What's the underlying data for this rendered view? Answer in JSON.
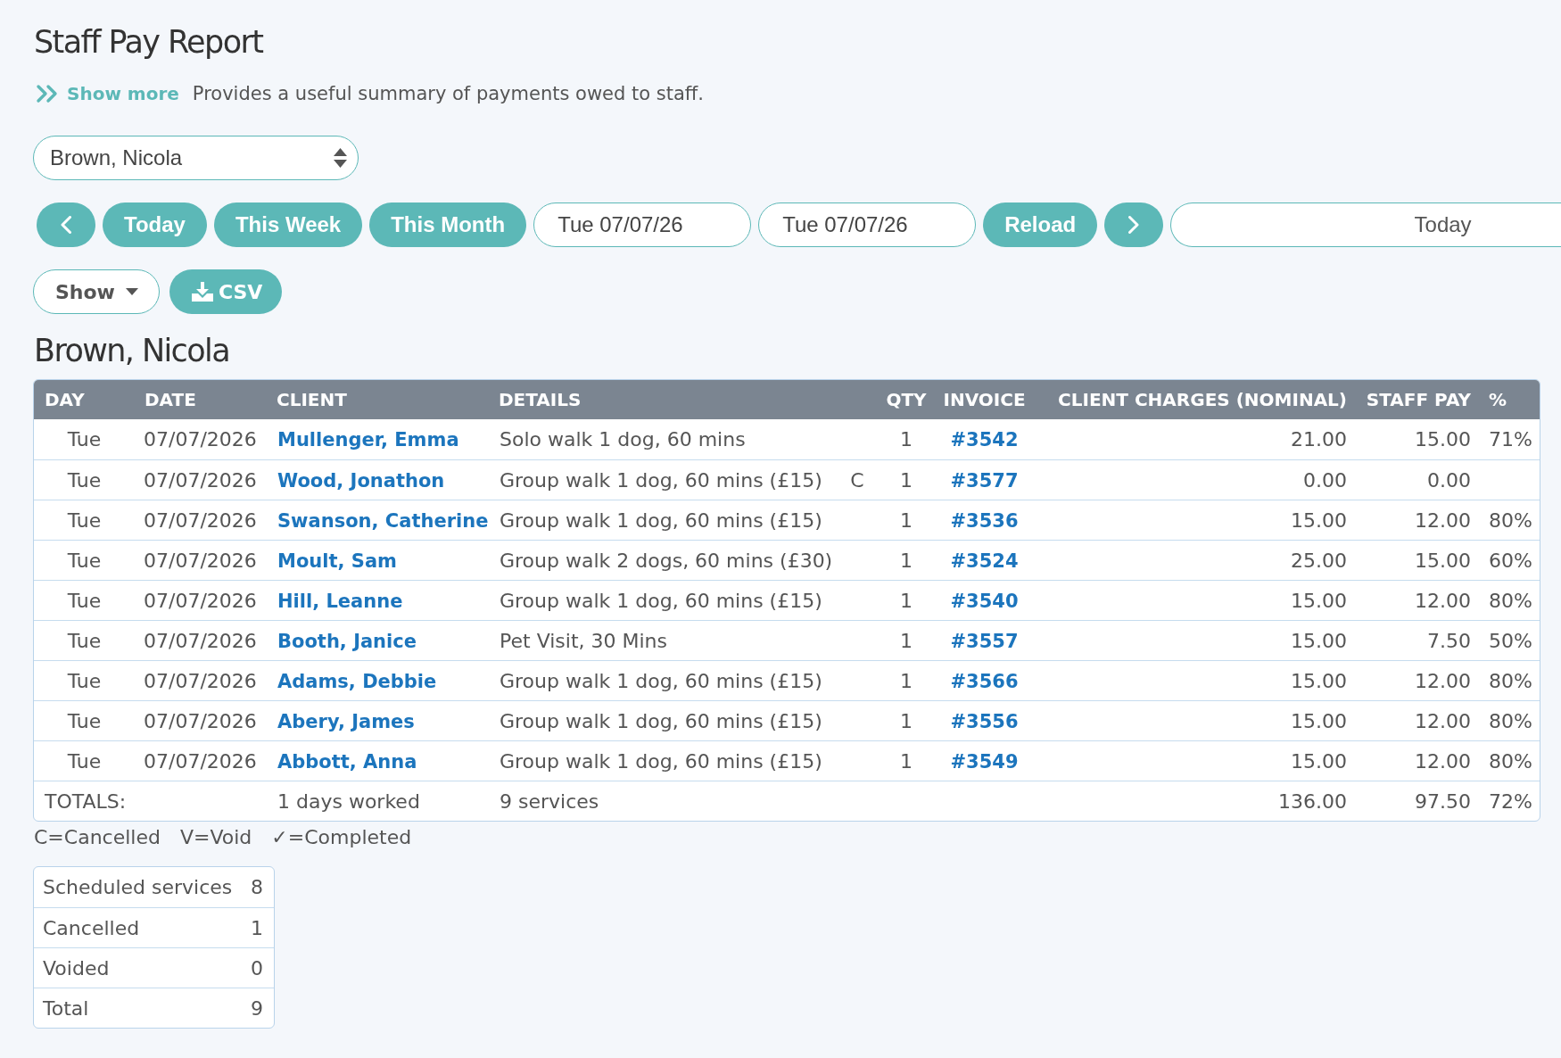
{
  "title": "Staff Pay Report",
  "intro": {
    "show_more": "Show more",
    "description": "Provides a useful summary of payments owed to staff."
  },
  "staff_select": {
    "value": "Brown, Nicola"
  },
  "date_toolbar": {
    "presets": [
      "Today",
      "This Week",
      "This Month"
    ],
    "start_date": {
      "value": "Tue 07/07/26"
    },
    "end_date": {
      "value": "Tue 07/07/26"
    },
    "reload": "Reload",
    "range": {
      "value": "Today"
    }
  },
  "actions": [
    {
      "kind": "dropdown",
      "label": "Show"
    },
    {
      "kind": "download",
      "label": "CSV"
    }
  ],
  "report": {
    "heading": "Brown, Nicola",
    "columns": [
      "DAY",
      "DATE",
      "CLIENT",
      "DETAILS",
      "QTY",
      "INVOICE",
      "CLIENT CHARGES (NOMINAL)",
      "STAFF PAY",
      "%"
    ],
    "rows": [
      {
        "day": "Tue",
        "date": "07/07/2026",
        "client": "Mullenger, Emma",
        "details": "Solo walk 1 dog, 60 mins",
        "qty": "1",
        "invoice": "#3542",
        "charges": "21.00",
        "staff_pay": "15.00",
        "percent": "71%"
      },
      {
        "day": "Tue",
        "date": "07/07/2026",
        "client": "Wood, Jonathon",
        "details": "Group walk 1 dog, 60 mins (£15)",
        "status": "C",
        "qty": "1",
        "invoice": "#3577",
        "charges": "0.00",
        "staff_pay": "0.00"
      },
      {
        "day": "Tue",
        "date": "07/07/2026",
        "client": "Swanson, Catherine",
        "details": "Group walk 1 dog, 60 mins (£15)",
        "qty": "1",
        "invoice": "#3536",
        "charges": "15.00",
        "staff_pay": "12.00",
        "percent": "80%"
      },
      {
        "day": "Tue",
        "date": "07/07/2026",
        "client": "Moult, Sam",
        "details": "Group walk 2 dogs, 60 mins (£30)",
        "qty": "1",
        "invoice": "#3524",
        "charges": "25.00",
        "staff_pay": "15.00",
        "percent": "60%"
      },
      {
        "day": "Tue",
        "date": "07/07/2026",
        "client": "Hill, Leanne",
        "details": "Group walk 1 dog, 60 mins (£15)",
        "qty": "1",
        "invoice": "#3540",
        "charges": "15.00",
        "staff_pay": "12.00",
        "percent": "80%"
      },
      {
        "day": "Tue",
        "date": "07/07/2026",
        "client": "Booth, Janice",
        "details": "Pet Visit, 30 Mins",
        "qty": "1",
        "invoice": "#3557",
        "charges": "15.00",
        "staff_pay": "7.50",
        "percent": "50%"
      },
      {
        "day": "Tue",
        "date": "07/07/2026",
        "client": "Adams, Debbie",
        "details": "Group walk 1 dog, 60 mins (£15)",
        "qty": "1",
        "invoice": "#3566",
        "charges": "15.00",
        "staff_pay": "12.00",
        "percent": "80%"
      },
      {
        "day": "Tue",
        "date": "07/07/2026",
        "client": "Abery, James",
        "details": "Group walk 1 dog, 60 mins (£15)",
        "qty": "1",
        "invoice": "#3556",
        "charges": "15.00",
        "staff_pay": "12.00",
        "percent": "80%"
      },
      {
        "day": "Tue",
        "date": "07/07/2026",
        "client": "Abbott, Anna",
        "details": "Group walk 1 dog, 60 mins (£15)",
        "qty": "1",
        "invoice": "#3549",
        "charges": "15.00",
        "staff_pay": "12.00",
        "percent": "80%"
      }
    ],
    "totals": {
      "label": "TOTALS:",
      "days": "1 days worked",
      "services": "9 services",
      "charges": "136.00",
      "staff_pay": "97.50",
      "percent": "72%"
    }
  },
  "legend": [
    "C=Cancelled",
    "V=Void",
    "✓=Completed"
  ],
  "summary": [
    {
      "label": "Scheduled services",
      "value": "8"
    },
    {
      "label": "Cancelled",
      "value": "1"
    },
    {
      "label": "Voided",
      "value": "0"
    },
    {
      "label": "Total",
      "value": "9"
    }
  ]
}
